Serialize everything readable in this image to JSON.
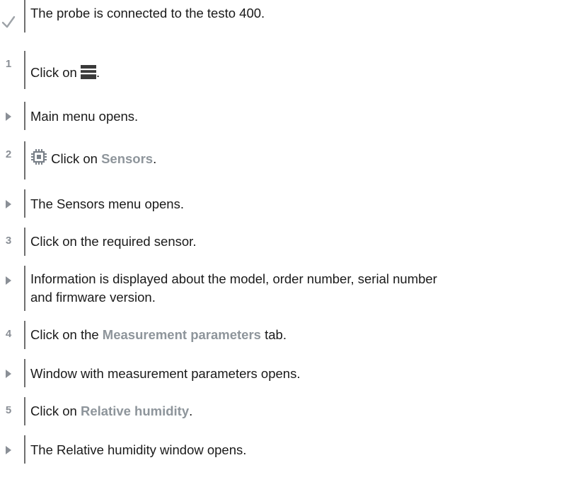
{
  "colors": {
    "accent_gray": "#8e959b",
    "bar": "#6f6f6f",
    "check_gray": "#9ea3a8",
    "arrow_gray": "#8a8f96"
  },
  "steps": [
    {
      "marker": "check-icon",
      "text": "The probe is connected to the testo 400."
    },
    {
      "marker": "1",
      "prefix": "Click on ",
      "icon": "hamburger-menu-icon",
      "suffix": "."
    },
    {
      "marker": "result-arrow-icon",
      "text": "Main menu opens."
    },
    {
      "marker": "2",
      "icon": "sensor-chip-icon",
      "prefix": " Click on ",
      "highlight": "Sensors",
      "suffix": "."
    },
    {
      "marker": "result-arrow-icon",
      "text": "The Sensors menu opens."
    },
    {
      "marker": "3",
      "text": "Click on the required sensor."
    },
    {
      "marker": "result-arrow-icon",
      "line1": "Information is displayed about the model, order number, serial number",
      "line2": "and firmware version."
    },
    {
      "marker": "4",
      "prefix": "Click on the ",
      "highlight": "Measurement parameters",
      "suffix": " tab."
    },
    {
      "marker": "result-arrow-icon",
      "text": "Window with measurement parameters opens."
    },
    {
      "marker": "5",
      "prefix": "Click on ",
      "highlight": "Relative humidity",
      "suffix": "."
    },
    {
      "marker": "result-arrow-icon",
      "text": "The Relative humidity window opens."
    }
  ]
}
